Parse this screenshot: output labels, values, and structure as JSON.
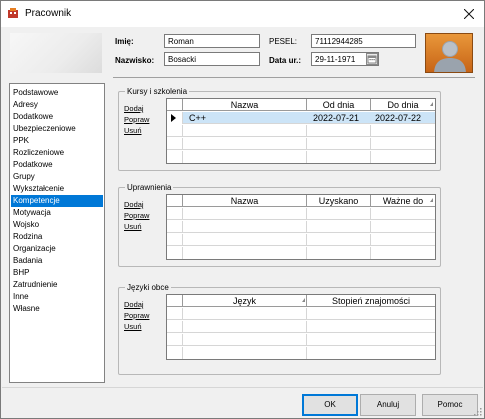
{
  "window": {
    "title": "Pracownik"
  },
  "header": {
    "imie_label": "Imię:",
    "imie_value": "Roman",
    "nazwisko_label": "Nazwisko:",
    "nazwisko_value": "Bosacki",
    "pesel_label": "PESEL:",
    "pesel_value": "71112944285",
    "data_ur_label": "Data ur.:",
    "data_ur_value": "29-11-1971"
  },
  "sidebar": {
    "items": [
      {
        "label": "Podstawowe",
        "selected": false
      },
      {
        "label": "Adresy",
        "selected": false
      },
      {
        "label": "Dodatkowe",
        "selected": false
      },
      {
        "label": "Ubezpieczeniowe",
        "selected": false
      },
      {
        "label": "PPK",
        "selected": false
      },
      {
        "label": "Rozliczeniowe",
        "selected": false
      },
      {
        "label": "Podatkowe",
        "selected": false
      },
      {
        "label": "Grupy",
        "selected": false
      },
      {
        "label": "Wykształcenie",
        "selected": false
      },
      {
        "label": "Kompetencje",
        "selected": true
      },
      {
        "label": "Motywacja",
        "selected": false
      },
      {
        "label": "Wojsko",
        "selected": false
      },
      {
        "label": "Rodzina",
        "selected": false
      },
      {
        "label": "Organizacje",
        "selected": false
      },
      {
        "label": "Badania",
        "selected": false
      },
      {
        "label": "BHP",
        "selected": false
      },
      {
        "label": "Zatrudnienie",
        "selected": false
      },
      {
        "label": "Inne",
        "selected": false
      },
      {
        "label": "Własne",
        "selected": false
      }
    ]
  },
  "actions": {
    "add": "Dodaj",
    "edit": "Popraw",
    "delete": "Usuń"
  },
  "kursy": {
    "title": "Kursy i szkolenia",
    "columns": [
      "Nazwa",
      "Od dnia",
      "Do dnia"
    ],
    "rows": [
      {
        "nazwa": "C++",
        "od": "2022-07-21",
        "do": "2022-07-22"
      }
    ]
  },
  "uprawnienia": {
    "title": "Uprawnienia",
    "columns": [
      "Nazwa",
      "Uzyskano",
      "Ważne do"
    ],
    "rows": []
  },
  "jezyki": {
    "title": "Języki obce",
    "columns": [
      "Język",
      "Stopień znajomości"
    ],
    "rows": []
  },
  "footer": {
    "ok": "OK",
    "cancel": "Anuluj",
    "help": "Pomoc"
  },
  "colors": {
    "accent": "#0078d7",
    "selected_row": "#cce4f7",
    "avatar": "#d97a26"
  },
  "icons": [
    "app-icon",
    "close-icon",
    "calendar-icon",
    "user-avatar-icon",
    "row-pointer-icon",
    "sort-icon",
    "resize-grip-icon"
  ]
}
